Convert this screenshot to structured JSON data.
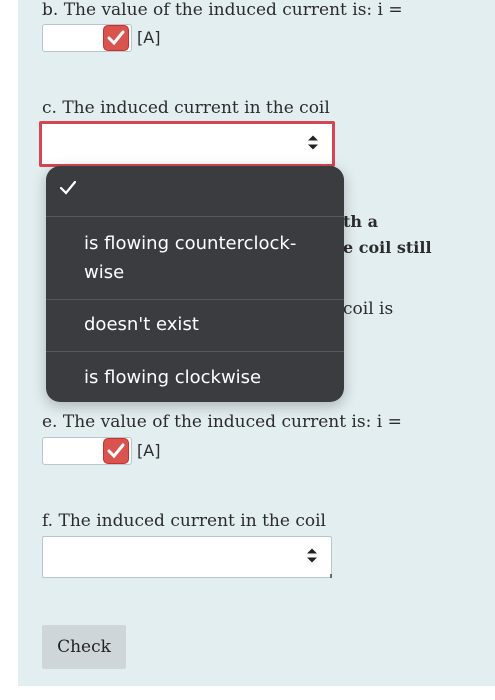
{
  "question_b": {
    "label": "b. The value of the induced current is:  i =",
    "input_value": "",
    "unit": "[A]"
  },
  "question_c": {
    "label": "c. The induced current in the coil",
    "selected": ""
  },
  "question_d_partial": {
    "line1": "th a",
    "line2": "e coil still",
    "line3": "coil is"
  },
  "dropdown": {
    "options": [
      {
        "label": "",
        "checked": true
      },
      {
        "label": "is flowing counterclock-\nwise",
        "checked": false
      },
      {
        "label": "doesn't exist",
        "checked": false
      },
      {
        "label": "is flowing clockwise",
        "checked": false
      }
    ]
  },
  "question_e": {
    "label": "e. The value of the induced current is:  i =",
    "input_value": "",
    "unit": "[A]"
  },
  "question_f": {
    "label": "f. The induced current in the coil",
    "selected": ""
  },
  "check_button": {
    "label": "Check"
  },
  "colors": {
    "panel_bg": "#e3eef1",
    "error_red": "#d64552",
    "badge_red": "#d9534f",
    "dropdown_bg": "#3a3c3f"
  },
  "icons": {
    "badge": "check-mark-icon",
    "select": "up-down-arrows-icon",
    "option_check": "checkmark-icon"
  }
}
